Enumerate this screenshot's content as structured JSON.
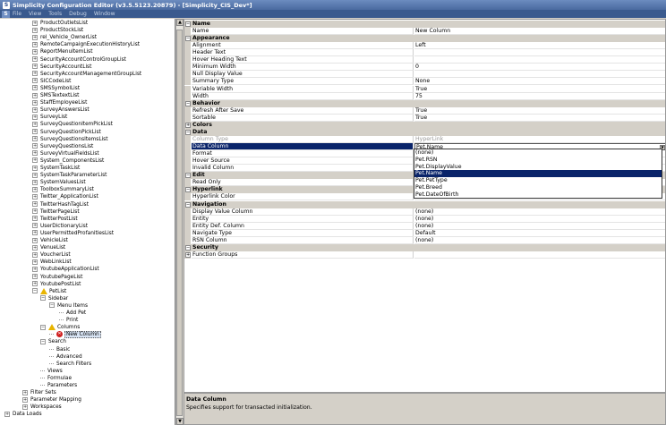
{
  "window": {
    "title": "Simplicity Configuration Editor (v3.5.5123.20879) - [Simplicity_CIS_Dev*]",
    "app_icon": "S"
  },
  "menu": [
    "File",
    "View",
    "Tools",
    "Debug",
    "Window"
  ],
  "tree": [
    {
      "label": "ProductOutletsList",
      "level": 0,
      "exp": "+"
    },
    {
      "label": "ProductStockList",
      "level": 0,
      "exp": "+"
    },
    {
      "label": "rel_Vehicle_OwnerList",
      "level": 0,
      "exp": "+"
    },
    {
      "label": "RemoteCampaignExecutionHistoryList",
      "level": 0,
      "exp": "+"
    },
    {
      "label": "ReportMenuItemList",
      "level": 0,
      "exp": "+"
    },
    {
      "label": "SecurityAccountControlGroupList",
      "level": 0,
      "exp": "+"
    },
    {
      "label": "SecurityAccountList",
      "level": 0,
      "exp": "+"
    },
    {
      "label": "SecurityAccountManagementGroupList",
      "level": 0,
      "exp": "+"
    },
    {
      "label": "SICCodeList",
      "level": 0,
      "exp": "+"
    },
    {
      "label": "SMSSymbolList",
      "level": 0,
      "exp": "+"
    },
    {
      "label": "SMSTextextList",
      "level": 0,
      "exp": "+"
    },
    {
      "label": "StaffEmployeeList",
      "level": 0,
      "exp": "+"
    },
    {
      "label": "SurveyAnswersList",
      "level": 0,
      "exp": "+"
    },
    {
      "label": "SurveyList",
      "level": 0,
      "exp": "+"
    },
    {
      "label": "SurveyQuestionItemPickList",
      "level": 0,
      "exp": "+"
    },
    {
      "label": "SurveyQuestionPickList",
      "level": 0,
      "exp": "+"
    },
    {
      "label": "SurveyQuestionsItemsList",
      "level": 0,
      "exp": "+"
    },
    {
      "label": "SurveyQuestionsList",
      "level": 0,
      "exp": "+"
    },
    {
      "label": "SurveyVirtualFieldsList",
      "level": 0,
      "exp": "+"
    },
    {
      "label": "System_ComponentsList",
      "level": 0,
      "exp": "+"
    },
    {
      "label": "SystemTaskList",
      "level": 0,
      "exp": "+"
    },
    {
      "label": "SystemTaskParameterList",
      "level": 0,
      "exp": "+"
    },
    {
      "label": "SystemValuesList",
      "level": 0,
      "exp": "+"
    },
    {
      "label": "ToolboxSummaryList",
      "level": 0,
      "exp": "+"
    },
    {
      "label": "Twitter_ApplicationList",
      "level": 0,
      "exp": "+"
    },
    {
      "label": "TwitterHashTagList",
      "level": 0,
      "exp": "+"
    },
    {
      "label": "TwitterPageList",
      "level": 0,
      "exp": "+"
    },
    {
      "label": "TwitterPostList",
      "level": 0,
      "exp": "+"
    },
    {
      "label": "UserDictionaryList",
      "level": 0,
      "exp": "+"
    },
    {
      "label": "UserPermittedProfanitiesList",
      "level": 0,
      "exp": "+"
    },
    {
      "label": "VehicleList",
      "level": 0,
      "exp": "+"
    },
    {
      "label": "VenueList",
      "level": 0,
      "exp": "+"
    },
    {
      "label": "VoucherList",
      "level": 0,
      "exp": "+"
    },
    {
      "label": "WebLinkList",
      "level": 0,
      "exp": "+"
    },
    {
      "label": "YoutubeApplicationList",
      "level": 0,
      "exp": "+"
    },
    {
      "label": "YoutubePageList",
      "level": 0,
      "exp": "+"
    },
    {
      "label": "YoutubePostList",
      "level": 0,
      "exp": "+"
    },
    {
      "label": "PetList",
      "level": 0,
      "exp": "-",
      "icon": "warn"
    },
    {
      "label": "Sidebar",
      "level": 1,
      "exp": "-"
    },
    {
      "label": "Menu Items",
      "level": 2,
      "exp": "-"
    },
    {
      "label": "Add Pet",
      "level": 3,
      "exp": ""
    },
    {
      "label": "Print",
      "level": 3,
      "exp": ""
    },
    {
      "label": "Columns",
      "level": 1,
      "exp": "-",
      "icon": "warn"
    },
    {
      "label": "New Column",
      "level": 2,
      "exp": "",
      "icon": "err",
      "selected": true
    },
    {
      "label": "Search",
      "level": 1,
      "exp": "-"
    },
    {
      "label": "Basic",
      "level": 2,
      "exp": ""
    },
    {
      "label": "Advanced",
      "level": 2,
      "exp": ""
    },
    {
      "label": "Search Filters",
      "level": 2,
      "exp": ""
    },
    {
      "label": "Views",
      "level": 1,
      "exp": ""
    },
    {
      "label": "Formulae",
      "level": 1,
      "exp": ""
    },
    {
      "label": "Parameters",
      "level": 1,
      "exp": ""
    },
    {
      "label": "Filter Sets",
      "level": -1,
      "exp": "+"
    },
    {
      "label": "Parameter Mapping",
      "level": -1,
      "exp": "+"
    },
    {
      "label": "Workspaces",
      "level": -1,
      "exp": "+"
    },
    {
      "label": "Data Loads",
      "level": -2,
      "exp": "+"
    }
  ],
  "properties": [
    {
      "type": "cat",
      "name": "Name"
    },
    {
      "name": "Name",
      "value": "New Column"
    },
    {
      "type": "cat",
      "name": "Appearance"
    },
    {
      "name": "Alignment",
      "value": "Left"
    },
    {
      "name": "Header Text",
      "value": ""
    },
    {
      "name": "Hover Heading Text",
      "value": ""
    },
    {
      "name": "Minimum Width",
      "value": "0"
    },
    {
      "name": "Null Display Value",
      "value": ""
    },
    {
      "name": "Summary Type",
      "value": "None"
    },
    {
      "name": "Variable Width",
      "value": "True"
    },
    {
      "name": "Width",
      "value": "75"
    },
    {
      "type": "cat",
      "name": "Behavior"
    },
    {
      "name": "Refresh After Save",
      "value": "True"
    },
    {
      "name": "Sortable",
      "value": "True"
    },
    {
      "type": "cat",
      "name": "Colors",
      "exp": "+"
    },
    {
      "type": "cat",
      "name": "Data"
    },
    {
      "name": "Column Type",
      "value": "HyperLink",
      "grey": true
    },
    {
      "name": "Data Column",
      "value": "Pet.Name",
      "active": true
    },
    {
      "name": "Format",
      "value": ""
    },
    {
      "name": "Hover Source",
      "value": ""
    },
    {
      "name": "Invalid Column",
      "value": ""
    },
    {
      "type": "cat",
      "name": "Edit"
    },
    {
      "name": "Read Only",
      "value": ""
    },
    {
      "type": "cat",
      "name": "Hyperlink"
    },
    {
      "name": "Hyperlink Color",
      "value": ""
    },
    {
      "type": "cat",
      "name": "Navigation"
    },
    {
      "name": "Display Value Column",
      "value": "(none)"
    },
    {
      "name": "Entity",
      "value": "(none)"
    },
    {
      "name": "Entity Def. Column",
      "value": "(none)"
    },
    {
      "name": "Navigate Type",
      "value": "Default"
    },
    {
      "name": "RSN Column",
      "value": "(none)"
    },
    {
      "type": "cat",
      "name": "Security"
    },
    {
      "name": "Function Groups",
      "value": "",
      "exp": "+"
    }
  ],
  "dropdown": {
    "options": [
      "(none)",
      "Pet.RSN",
      "Pet.DisplayValue",
      "Pet.Name",
      "Pet.PetType",
      "Pet.Breed",
      "Pet.DateOfBirth"
    ],
    "selected_index": 3
  },
  "description": {
    "title": "Data Column",
    "text": "Specifies support for transacted initialization."
  }
}
